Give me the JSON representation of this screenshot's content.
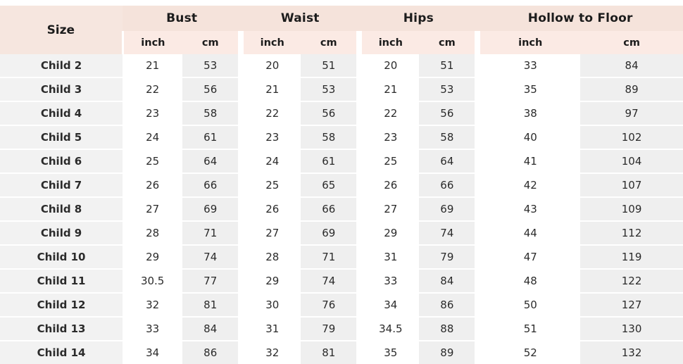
{
  "table": {
    "size_header": "Size",
    "groups": [
      {
        "label": "Bust"
      },
      {
        "label": "Waist"
      },
      {
        "label": "Hips"
      },
      {
        "label": "Hollow to Floor"
      }
    ],
    "unit_headers": [
      "inch",
      "cm",
      "inch",
      "cm",
      "inch",
      "cm",
      "inch",
      "cm"
    ],
    "rows": [
      {
        "size": "Child 2",
        "values": [
          "21",
          "53",
          "20",
          "51",
          "20",
          "51",
          "33",
          "84"
        ]
      },
      {
        "size": "Child 3",
        "values": [
          "22",
          "56",
          "21",
          "53",
          "21",
          "53",
          "35",
          "89"
        ]
      },
      {
        "size": "Child 4",
        "values": [
          "23",
          "58",
          "22",
          "56",
          "22",
          "56",
          "38",
          "97"
        ]
      },
      {
        "size": "Child 5",
        "values": [
          "24",
          "61",
          "23",
          "58",
          "23",
          "58",
          "40",
          "102"
        ]
      },
      {
        "size": "Child 6",
        "values": [
          "25",
          "64",
          "24",
          "61",
          "25",
          "64",
          "41",
          "104"
        ]
      },
      {
        "size": "Child 7",
        "values": [
          "26",
          "66",
          "25",
          "65",
          "26",
          "66",
          "42",
          "107"
        ]
      },
      {
        "size": "Child 8",
        "values": [
          "27",
          "69",
          "26",
          "66",
          "27",
          "69",
          "43",
          "109"
        ]
      },
      {
        "size": "Child 9",
        "values": [
          "28",
          "71",
          "27",
          "69",
          "29",
          "74",
          "44",
          "112"
        ]
      },
      {
        "size": "Child 10",
        "values": [
          "29",
          "74",
          "28",
          "71",
          "31",
          "79",
          "47",
          "119"
        ]
      },
      {
        "size": "Child 11",
        "values": [
          "30.5",
          "77",
          "29",
          "74",
          "33",
          "84",
          "48",
          "122"
        ]
      },
      {
        "size": "Child 12",
        "values": [
          "32",
          "81",
          "30",
          "76",
          "34",
          "86",
          "50",
          "127"
        ]
      },
      {
        "size": "Child 13",
        "values": [
          "33",
          "84",
          "31",
          "79",
          "34.5",
          "88",
          "51",
          "130"
        ]
      },
      {
        "size": "Child 14",
        "values": [
          "34",
          "86",
          "32",
          "81",
          "35",
          "89",
          "52",
          "132"
        ]
      }
    ],
    "colors": {
      "group_header_bg": "#f5e3db",
      "size_header_bg": "#f6e6df",
      "unit_header_bg": "#fbeae4",
      "size_cell_bg": "#f2f2f2",
      "inch_cell_bg": "#ffffff",
      "cm_cell_bg": "#efefef",
      "text": "#1c1c1c",
      "page_bg": "#ffffff"
    }
  }
}
